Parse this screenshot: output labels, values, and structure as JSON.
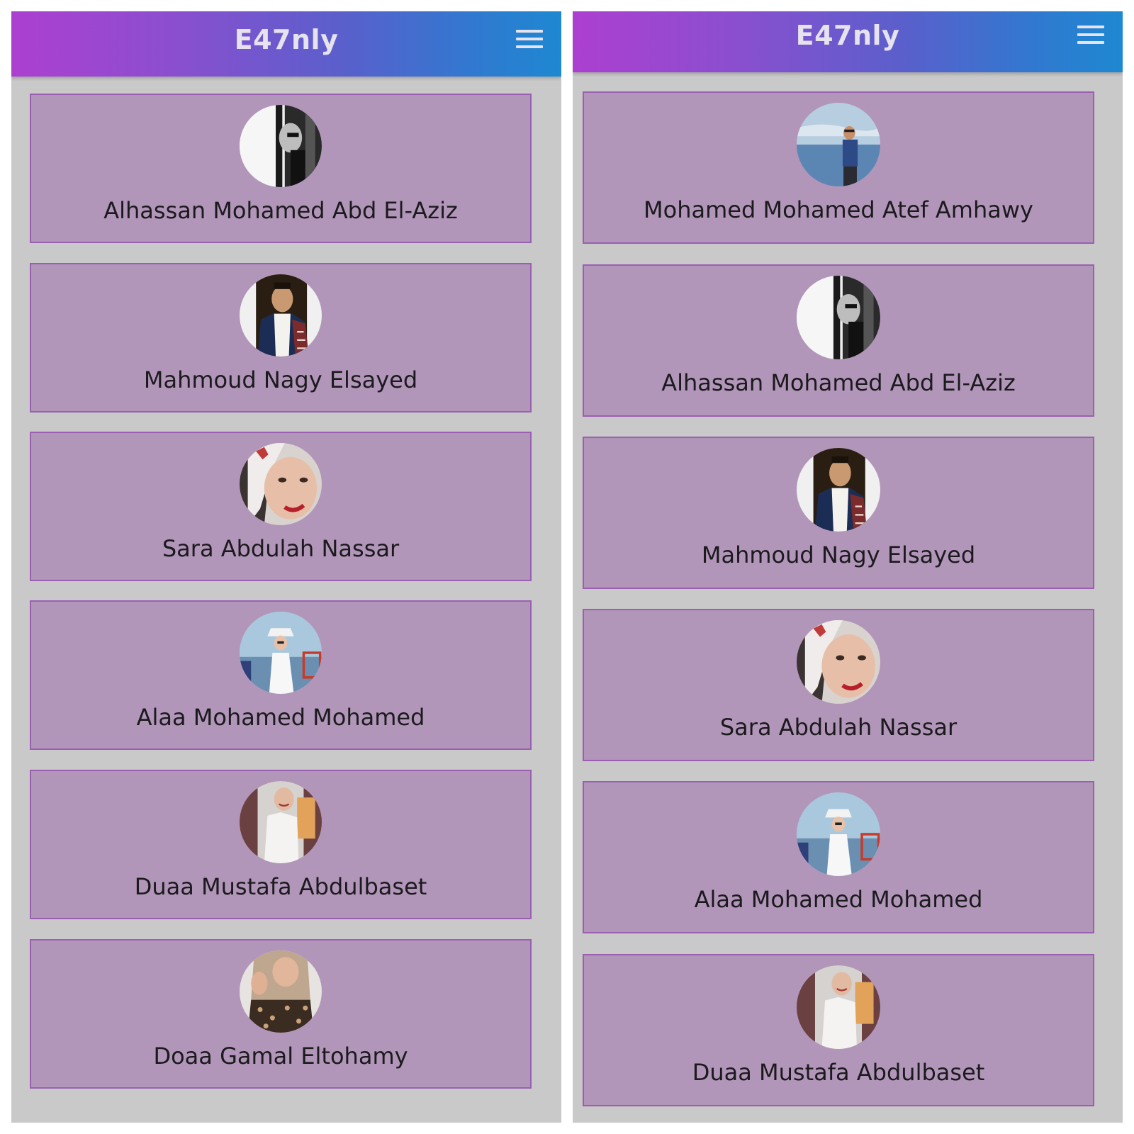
{
  "screens": [
    {
      "app_title": "E47nly",
      "members": [
        {
          "name": "Alhassan Mohamed Abd El-Aziz",
          "photo": "bw-profile-photo"
        },
        {
          "name": "Mahmoud Nagy Elsayed",
          "photo": "young-man-jacket-photo"
        },
        {
          "name": "Sara Abdulah Nassar",
          "photo": "woman-hijab-smile-photo"
        },
        {
          "name": "Alaa Mohamed Mohamed",
          "photo": "woman-white-dress-sea-photo"
        },
        {
          "name": "Duaa Mustafa Abdulbaset",
          "photo": "woman-white-blouse-photo"
        },
        {
          "name": "Doaa Gamal Eltohamy",
          "photo": "woman-hijab-leopard-photo"
        }
      ]
    },
    {
      "app_title": "E47nly",
      "members": [
        {
          "name": "Mohamed Mohamed Atef Amhawy",
          "photo": "man-at-sea-photo"
        },
        {
          "name": "Alhassan Mohamed Abd El-Aziz",
          "photo": "bw-profile-photo"
        },
        {
          "name": "Mahmoud Nagy Elsayed",
          "photo": "young-man-jacket-photo"
        },
        {
          "name": "Sara Abdulah Nassar",
          "photo": "woman-hijab-smile-photo"
        },
        {
          "name": "Alaa Mohamed Mohamed",
          "photo": "woman-white-dress-sea-photo"
        },
        {
          "name": "Duaa Mustafa Abdulbaset",
          "photo": "woman-white-blouse-photo"
        }
      ]
    }
  ],
  "colors": {
    "app_bar_gradient": [
      "#ad3fd0",
      "#1e88d2"
    ],
    "card_background": "#b296ba",
    "card_border": "#9b5fb1",
    "screen_background": "#c9c9c9",
    "name_text": "#1b1a1d"
  },
  "icons": {
    "menu": "hamburger-menu-icon"
  }
}
